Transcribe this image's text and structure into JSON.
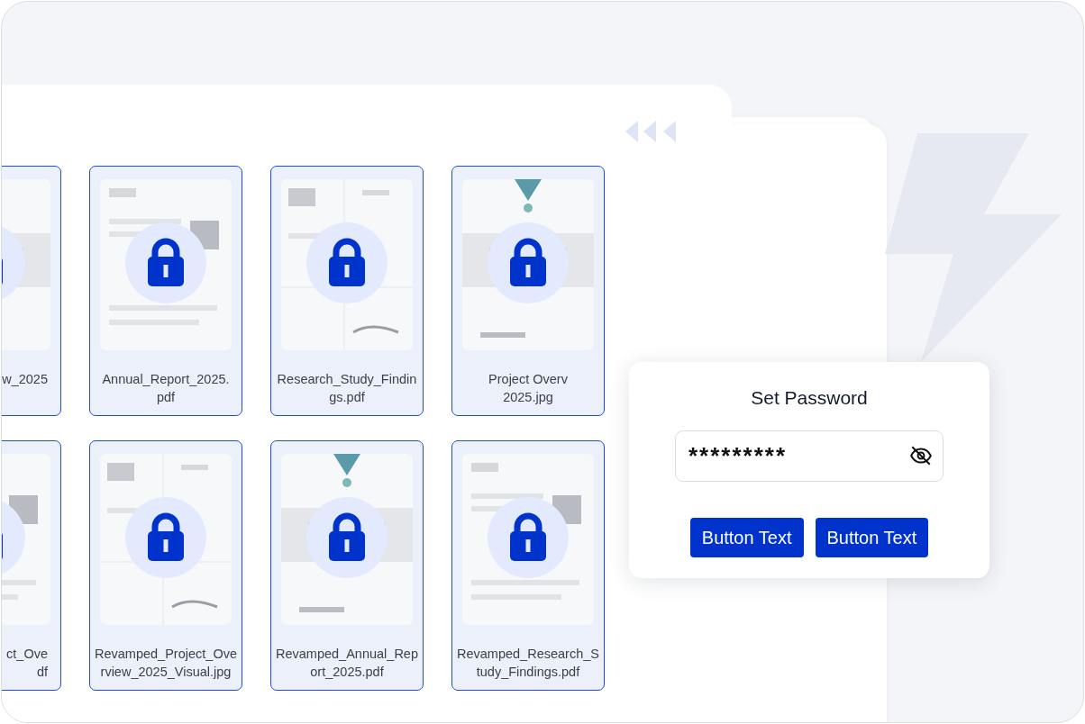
{
  "files": [
    {
      "lines": [
        "w_2025"
      ],
      "selected": true,
      "locked": true,
      "kind": "partial"
    },
    {
      "lines": [
        "Annual_Report_2025.",
        "pdf"
      ],
      "selected": true,
      "locked": true,
      "kind": "full"
    },
    {
      "lines": [
        "Research_Study_Findin",
        "gs.pdf"
      ],
      "selected": true,
      "locked": true,
      "kind": "full"
    },
    {
      "lines": [
        "Project Overv",
        "2025.jpg"
      ],
      "selected": true,
      "locked": true,
      "kind": "full"
    },
    {
      "lines": [
        "ct_Ove",
        "df"
      ],
      "selected": true,
      "locked": true,
      "kind": "partial"
    },
    {
      "lines": [
        "Revamped_Project_Ove",
        "rview_2025_Visual.jpg"
      ],
      "selected": true,
      "locked": true,
      "kind": "full"
    },
    {
      "lines": [
        "Revamped_Annual_Rep",
        "ort_2025.pdf"
      ],
      "selected": true,
      "locked": true,
      "kind": "full"
    },
    {
      "lines": [
        "Revamped_Research_S",
        "tudy_Findings.pdf"
      ],
      "selected": true,
      "locked": true,
      "kind": "full"
    }
  ],
  "dialog": {
    "title": "Set Password",
    "password": {
      "value": "*********"
    },
    "buttons": [
      "Button Text",
      "Button Text"
    ]
  }
}
